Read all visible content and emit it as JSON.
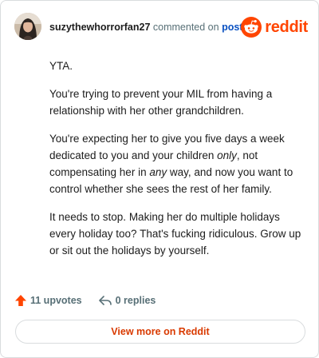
{
  "header": {
    "username": "suzythewhorrorfan27",
    "action_text": "commented on",
    "post_link": "post",
    "brand_wordmark": "reddit"
  },
  "comment": {
    "paragraphs": [
      {
        "segments": [
          {
            "text": "YTA.",
            "italic": false
          }
        ]
      },
      {
        "segments": [
          {
            "text": "You're trying to prevent your MIL from having a relationship with her other grandchildren.",
            "italic": false
          }
        ]
      },
      {
        "segments": [
          {
            "text": "You're expecting her to give you five days a week dedicated to you and your children ",
            "italic": false
          },
          {
            "text": "only",
            "italic": true
          },
          {
            "text": ", not compensating her in ",
            "italic": false
          },
          {
            "text": "any",
            "italic": true
          },
          {
            "text": " way, and now you want to control whether she sees the rest of her family.",
            "italic": false
          }
        ]
      },
      {
        "segments": [
          {
            "text": "It needs to stop. Making her do multiple holidays every holiday too? That's fucking ridiculous. Grow up or sit out the holidays by yourself.",
            "italic": false
          }
        ]
      }
    ]
  },
  "footer": {
    "upvotes_label": "11 upvotes",
    "replies_label": "0 replies"
  },
  "view_more_label": "View more on Reddit",
  "colors": {
    "brand": "#ff4500",
    "upvote": "#ff4500",
    "link": "#0a51c2",
    "view_more_text": "#d93a00",
    "muted": "#576f76"
  },
  "icons": {
    "avatar": "user-avatar",
    "brand": "reddit-snoo-icon",
    "upvote": "upvote-arrow-icon",
    "reply": "reply-arrow-icon"
  }
}
